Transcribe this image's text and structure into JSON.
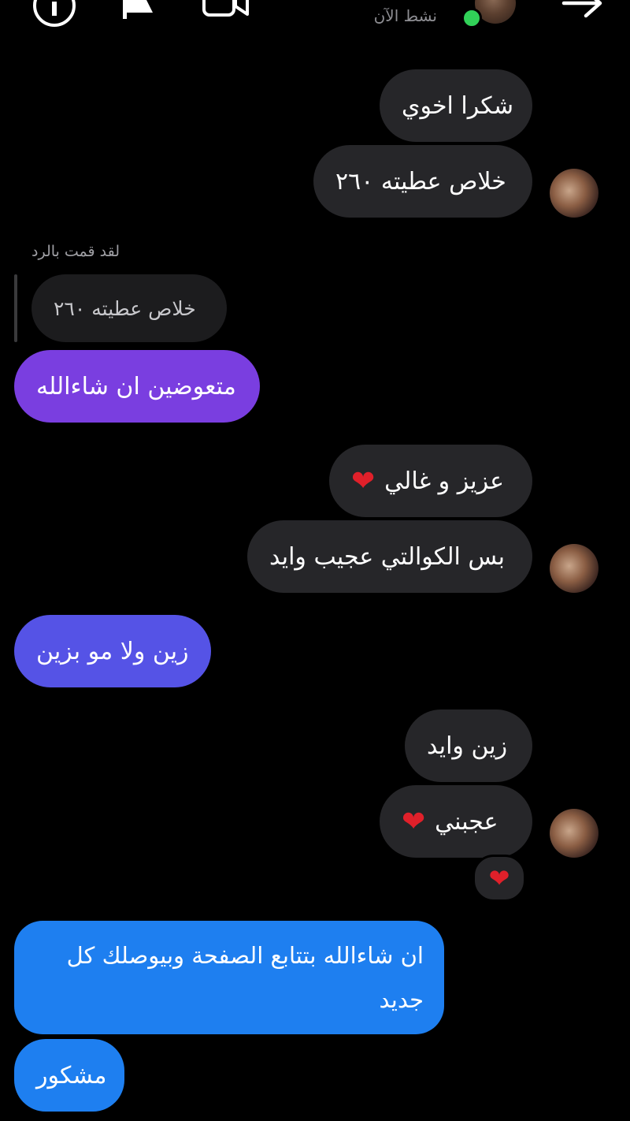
{
  "header": {
    "status": "نشط الآن",
    "icons": [
      "info-icon",
      "flag-icon",
      "video-icon",
      "back-arrow-icon"
    ]
  },
  "messages": {
    "m1": "شكرا اخوي",
    "m2": "خلاص عطيته ٢٦٠",
    "reply_label": "لقد قمت بالرد",
    "reply_quote": "خلاص عطيته ٢٦٠",
    "m3": "متعوضين ان شاءالله",
    "m4": "عزيز و غالي",
    "m5": "بس الكوالتي عجيب وايد",
    "m6": "زين ولا مو بزين",
    "m7": "زين وايد",
    "m8": "عجبني",
    "m9": "ان شاءالله بتتابع الصفحة وبيوصلك كل جديد",
    "m10": "مشكور"
  },
  "colors": {
    "incoming": "#262629",
    "outgoing_purple": "#7a3ee0",
    "outgoing_indigo": "#5553e6",
    "outgoing_blue": "#1e7ff0",
    "online": "#31d158",
    "heart": "#e0202a"
  }
}
